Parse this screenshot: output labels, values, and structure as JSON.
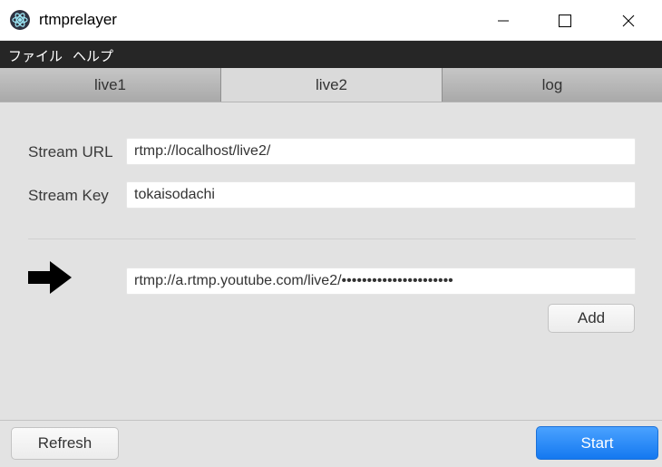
{
  "window": {
    "title": "rtmprelayer",
    "minimize_icon": "minimize-icon",
    "maximize_icon": "maximize-icon",
    "close_icon": "close-icon"
  },
  "menu": {
    "items": [
      "ファイル",
      "ヘルプ"
    ]
  },
  "tabs": [
    {
      "label": "live1",
      "active": false
    },
    {
      "label": "live2",
      "active": true
    },
    {
      "label": "log",
      "active": false
    }
  ],
  "stream": {
    "url_label": "Stream URL",
    "url_value": "rtmp://localhost/live2/",
    "key_label": "Stream Key",
    "key_value": "tokaisodachi"
  },
  "relay": {
    "arrow_icon": "arrow-right-icon",
    "destination_value": "rtmp://a.rtmp.youtube.com/live2/••••••••••••••••••••••",
    "add_label": "Add"
  },
  "footer": {
    "refresh_label": "Refresh",
    "start_label": "Start"
  },
  "colors": {
    "menubar": "#262626",
    "content_bg": "#e2e2e2",
    "primary": "#1e86f5"
  }
}
